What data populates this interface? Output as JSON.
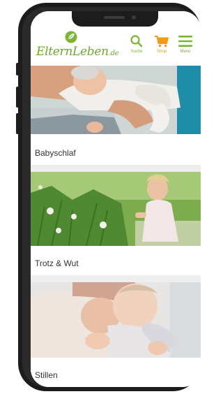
{
  "header": {
    "logo": {
      "text": "ElternLeben",
      "tld": ".de"
    },
    "nav": [
      {
        "label": "Suche",
        "icon": "search-icon"
      },
      {
        "label": "Shop",
        "icon": "cart-icon"
      },
      {
        "label": "Menü",
        "icon": "hamburger-menu-icon"
      }
    ]
  },
  "cards": [
    {
      "title": "Babyschlaf",
      "image": "sleeping-baby-photo"
    },
    {
      "title": "Trotz & Wut",
      "image": "toddler-in-meadow-photo"
    },
    {
      "title": "Stillen",
      "image": "breastfeeding-baby-photo"
    }
  ],
  "colors": {
    "brand_green": "#7ab536",
    "shop_orange": "#f39b12",
    "label_text": "#333333"
  }
}
